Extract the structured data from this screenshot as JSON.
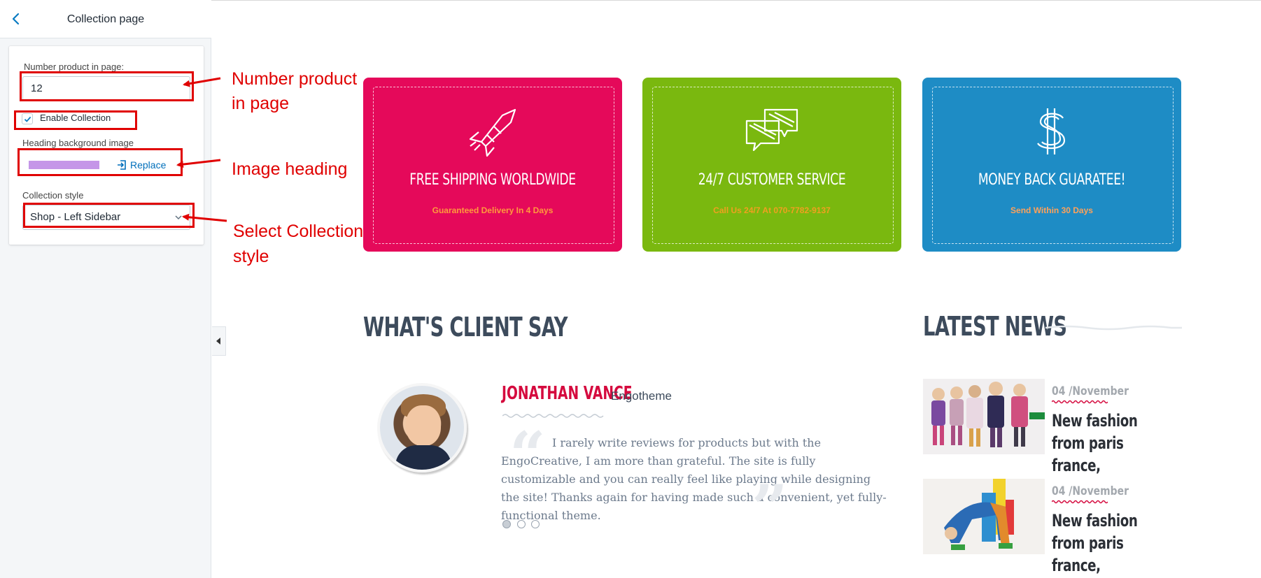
{
  "sidebar": {
    "title": "Collection page",
    "number_label": "Number product in page:",
    "number_value": "12",
    "enable_label": "Enable Collection",
    "enable_checked": true,
    "heading_bg_label": "Heading background image",
    "replace_label": "Replace",
    "style_label": "Collection style",
    "style_value": "Shop - Left Sidebar"
  },
  "annotations": {
    "number": [
      "Number product",
      "in page"
    ],
    "image": "Image heading",
    "select": [
      "Select Collection",
      "style"
    ]
  },
  "features": [
    {
      "title": "FREE SHIPPING WORLDWIDE",
      "subtitle": "Guaranteed Delivery In 4 Days",
      "color": "#e5095a",
      "subcolor": "#ff9a3c",
      "icon": "rocket-icon"
    },
    {
      "title": "24/7 CUSTOMER SERVICE",
      "subtitle": "Call Us 24/7 At 070-7782-9137",
      "color": "#7ab80f",
      "subcolor": "#f0a020",
      "icon": "chat-bubbles-icon"
    },
    {
      "title": "MONEY BACK GUARATEE!",
      "subtitle": "Send Within 30 Days",
      "color": "#1e8cc5",
      "subcolor": "#ffa25a",
      "icon": "dollar-icon"
    }
  ],
  "testimonial": {
    "heading": "WHAT'S CLIENT SAY",
    "name": "JONATHAN VANCE",
    "company": "Engotheme",
    "quote": "I rarely write reviews for products but with the EngoCreative, I am more than grateful. The site is fully customizable and you can really feel like playing while designing the site! Thanks again for having made such a convenient, yet fully-functional theme."
  },
  "news": {
    "heading": "LATEST NEWS",
    "items": [
      {
        "date": "04 /November",
        "title": "New fashion from paris france,"
      },
      {
        "date": "04 /November",
        "title": "New fashion from paris france,"
      }
    ]
  },
  "colors": {
    "annotation": "#e00000",
    "link": "#006fbb",
    "heading": "#3d4b5c",
    "accent_red": "#d50a3e"
  }
}
